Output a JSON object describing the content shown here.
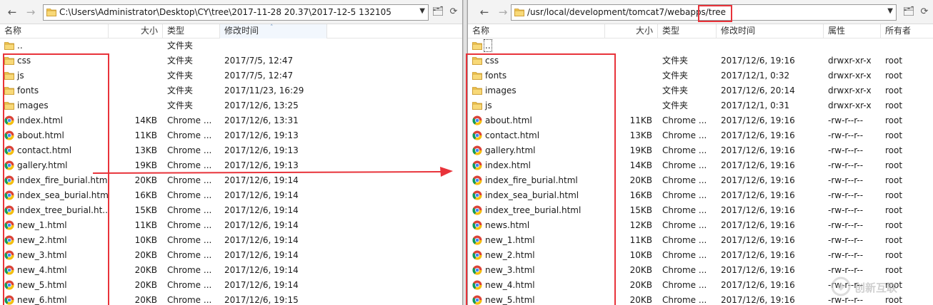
{
  "left": {
    "address": "C:\\Users\\Administrator\\Desktop\\CY\\tree\\2017-11-28 20.37\\2017-12-5 132105",
    "columns": {
      "name": "名称",
      "size": "大小",
      "type": "类型",
      "modified": "修改时间"
    },
    "files": [
      {
        "name": "..",
        "size": "",
        "type": "文件夹",
        "modified": "",
        "icon": "parent-folder-icon"
      },
      {
        "name": "css",
        "size": "",
        "type": "文件夹",
        "modified": "2017/7/5, 12:47",
        "icon": "folder-icon"
      },
      {
        "name": "js",
        "size": "",
        "type": "文件夹",
        "modified": "2017/7/5, 12:47",
        "icon": "folder-icon"
      },
      {
        "name": "fonts",
        "size": "",
        "type": "文件夹",
        "modified": "2017/11/23, 16:29",
        "icon": "folder-icon"
      },
      {
        "name": "images",
        "size": "",
        "type": "文件夹",
        "modified": "2017/12/6, 13:25",
        "icon": "folder-icon"
      },
      {
        "name": "index.html",
        "size": "14KB",
        "type": "Chrome ...",
        "modified": "2017/12/6, 13:31",
        "icon": "chrome-icon"
      },
      {
        "name": "about.html",
        "size": "11KB",
        "type": "Chrome ...",
        "modified": "2017/12/6, 19:13",
        "icon": "chrome-icon"
      },
      {
        "name": "contact.html",
        "size": "13KB",
        "type": "Chrome ...",
        "modified": "2017/12/6, 19:13",
        "icon": "chrome-icon"
      },
      {
        "name": "gallery.html",
        "size": "19KB",
        "type": "Chrome ...",
        "modified": "2017/12/6, 19:13",
        "icon": "chrome-icon"
      },
      {
        "name": "index_fire_burial.html",
        "size": "20KB",
        "type": "Chrome ...",
        "modified": "2017/12/6, 19:14",
        "icon": "chrome-icon"
      },
      {
        "name": "index_sea_burial.html",
        "size": "16KB",
        "type": "Chrome ...",
        "modified": "2017/12/6, 19:14",
        "icon": "chrome-icon"
      },
      {
        "name": "index_tree_burial.ht...",
        "size": "15KB",
        "type": "Chrome ...",
        "modified": "2017/12/6, 19:14",
        "icon": "chrome-icon"
      },
      {
        "name": "new_1.html",
        "size": "11KB",
        "type": "Chrome ...",
        "modified": "2017/12/6, 19:14",
        "icon": "chrome-icon"
      },
      {
        "name": "new_2.html",
        "size": "10KB",
        "type": "Chrome ...",
        "modified": "2017/12/6, 19:14",
        "icon": "chrome-icon"
      },
      {
        "name": "new_3.html",
        "size": "20KB",
        "type": "Chrome ...",
        "modified": "2017/12/6, 19:14",
        "icon": "chrome-icon"
      },
      {
        "name": "new_4.html",
        "size": "20KB",
        "type": "Chrome ...",
        "modified": "2017/12/6, 19:14",
        "icon": "chrome-icon"
      },
      {
        "name": "new_5.html",
        "size": "20KB",
        "type": "Chrome ...",
        "modified": "2017/12/6, 19:14",
        "icon": "chrome-icon"
      },
      {
        "name": "new_6.html",
        "size": "20KB",
        "type": "Chrome ...",
        "modified": "2017/12/6, 19:15",
        "icon": "chrome-icon"
      }
    ]
  },
  "right": {
    "address_prefix": "/usr/local/development/tomcat7/webapps/",
    "address_highlight": "tree",
    "columns": {
      "name": "名称",
      "size": "大小",
      "type": "类型",
      "modified": "修改时间",
      "perms": "属性",
      "owner": "所有者"
    },
    "files": [
      {
        "name": "..",
        "size": "",
        "type": "",
        "modified": "",
        "perms": "",
        "owner": "",
        "icon": "parent-folder-icon"
      },
      {
        "name": "css",
        "size": "",
        "type": "文件夹",
        "modified": "2017/12/6, 19:16",
        "perms": "drwxr-xr-x",
        "owner": "root",
        "icon": "folder-icon"
      },
      {
        "name": "fonts",
        "size": "",
        "type": "文件夹",
        "modified": "2017/12/1, 0:32",
        "perms": "drwxr-xr-x",
        "owner": "root",
        "icon": "folder-icon"
      },
      {
        "name": "images",
        "size": "",
        "type": "文件夹",
        "modified": "2017/12/6, 20:14",
        "perms": "drwxr-xr-x",
        "owner": "root",
        "icon": "folder-icon"
      },
      {
        "name": "js",
        "size": "",
        "type": "文件夹",
        "modified": "2017/12/1, 0:31",
        "perms": "drwxr-xr-x",
        "owner": "root",
        "icon": "folder-icon"
      },
      {
        "name": "about.html",
        "size": "11KB",
        "type": "Chrome ...",
        "modified": "2017/12/6, 19:16",
        "perms": "-rw-r--r--",
        "owner": "root",
        "icon": "chrome-icon"
      },
      {
        "name": "contact.html",
        "size": "13KB",
        "type": "Chrome ...",
        "modified": "2017/12/6, 19:16",
        "perms": "-rw-r--r--",
        "owner": "root",
        "icon": "chrome-icon"
      },
      {
        "name": "gallery.html",
        "size": "19KB",
        "type": "Chrome ...",
        "modified": "2017/12/6, 19:16",
        "perms": "-rw-r--r--",
        "owner": "root",
        "icon": "chrome-icon"
      },
      {
        "name": "index.html",
        "size": "14KB",
        "type": "Chrome ...",
        "modified": "2017/12/6, 19:16",
        "perms": "-rw-r--r--",
        "owner": "root",
        "icon": "chrome-icon"
      },
      {
        "name": "index_fire_burial.html",
        "size": "20KB",
        "type": "Chrome ...",
        "modified": "2017/12/6, 19:16",
        "perms": "-rw-r--r--",
        "owner": "root",
        "icon": "chrome-icon"
      },
      {
        "name": "index_sea_burial.html",
        "size": "16KB",
        "type": "Chrome ...",
        "modified": "2017/12/6, 19:16",
        "perms": "-rw-r--r--",
        "owner": "root",
        "icon": "chrome-icon"
      },
      {
        "name": "index_tree_burial.html",
        "size": "15KB",
        "type": "Chrome ...",
        "modified": "2017/12/6, 19:16",
        "perms": "-rw-r--r--",
        "owner": "root",
        "icon": "chrome-icon"
      },
      {
        "name": "news.html",
        "size": "12KB",
        "type": "Chrome ...",
        "modified": "2017/12/6, 19:16",
        "perms": "-rw-r--r--",
        "owner": "root",
        "icon": "chrome-icon"
      },
      {
        "name": "new_1.html",
        "size": "11KB",
        "type": "Chrome ...",
        "modified": "2017/12/6, 19:16",
        "perms": "-rw-r--r--",
        "owner": "root",
        "icon": "chrome-icon"
      },
      {
        "name": "new_2.html",
        "size": "10KB",
        "type": "Chrome ...",
        "modified": "2017/12/6, 19:16",
        "perms": "-rw-r--r--",
        "owner": "root",
        "icon": "chrome-icon"
      },
      {
        "name": "new_3.html",
        "size": "20KB",
        "type": "Chrome ...",
        "modified": "2017/12/6, 19:16",
        "perms": "-rw-r--r--",
        "owner": "root",
        "icon": "chrome-icon"
      },
      {
        "name": "new_4.html",
        "size": "20KB",
        "type": "Chrome ...",
        "modified": "2017/12/6, 19:16",
        "perms": "-rw-r--r--",
        "owner": "root",
        "icon": "chrome-icon"
      },
      {
        "name": "new_5.html",
        "size": "20KB",
        "type": "Chrome ...",
        "modified": "2017/12/6, 19:16",
        "perms": "-rw-r--r--",
        "owner": "root",
        "icon": "chrome-icon"
      }
    ]
  },
  "colors": {
    "annotation": "#e8333a",
    "folder": "#e9b83e",
    "header_sorted": "#f2f7fd"
  }
}
